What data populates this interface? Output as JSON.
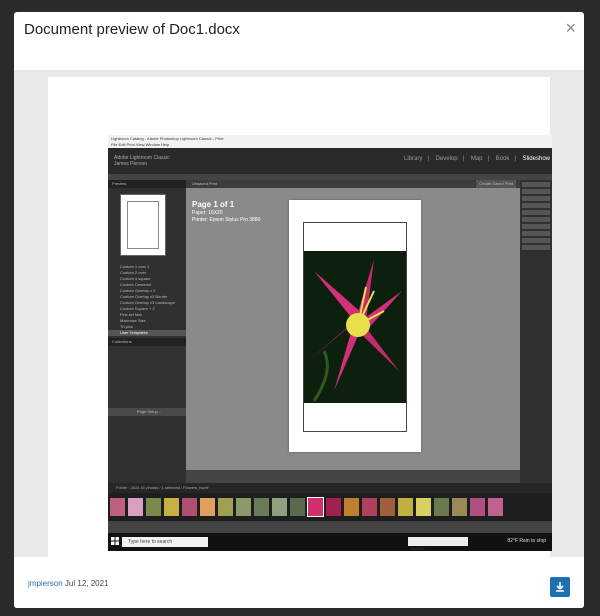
{
  "modal": {
    "title": "Document preview of Doc1.docx",
    "close_label": "×",
    "author": "jmpierson",
    "date": "Jul 12, 2021",
    "download_icon": "download-icon"
  },
  "screenshot": {
    "titlebar": "Lightroom Catalog - Adobe Photoshop Lightroom Classic - Print",
    "menubar": "File  Edit  Print  View  Window  Help",
    "identity_line1": "Adobe Lightroom Classic",
    "identity_line2": "James Pierson",
    "modules": [
      "Library",
      "Develop",
      "Map",
      "Book",
      "Slideshow"
    ],
    "active_module": "Slideshow",
    "left_panel_title": "Preview",
    "templates": [
      "Custom 1 over 1",
      "Custom 2 over",
      "Custom 4 square",
      "Custom Centered",
      "Custom Overlap x 3",
      "Custom Overlap x3 Border",
      "Custom Overlap x3 Landscape",
      "Custom Square + 2",
      "Fine Art Mat",
      "Maximize Size",
      "Tri-pick",
      "User Templates"
    ],
    "collections_title": "Collections",
    "page_setup_label": "Page Setup...",
    "center_bar_label": "Unsaved Print",
    "center_button": "Create Saved Print",
    "page_info": "Page 1 of 1",
    "paper": "Paper:  16X20",
    "printer": "Printer:  Epson Stylus Pro 3880",
    "filmstrip_info": "Folder : 2021   41 photos / 1 selected / Flowers_bw.tif",
    "taskbar_search": "Type here to search",
    "taskbar_address": "Address",
    "taskbar_weather": "82°F  Rain to stop"
  },
  "colors": {
    "accent": "#1f6fb5",
    "flower_pink": "#d0317a",
    "flower_yellow": "#e8e04a",
    "backdrop": "#2b2b2b"
  }
}
